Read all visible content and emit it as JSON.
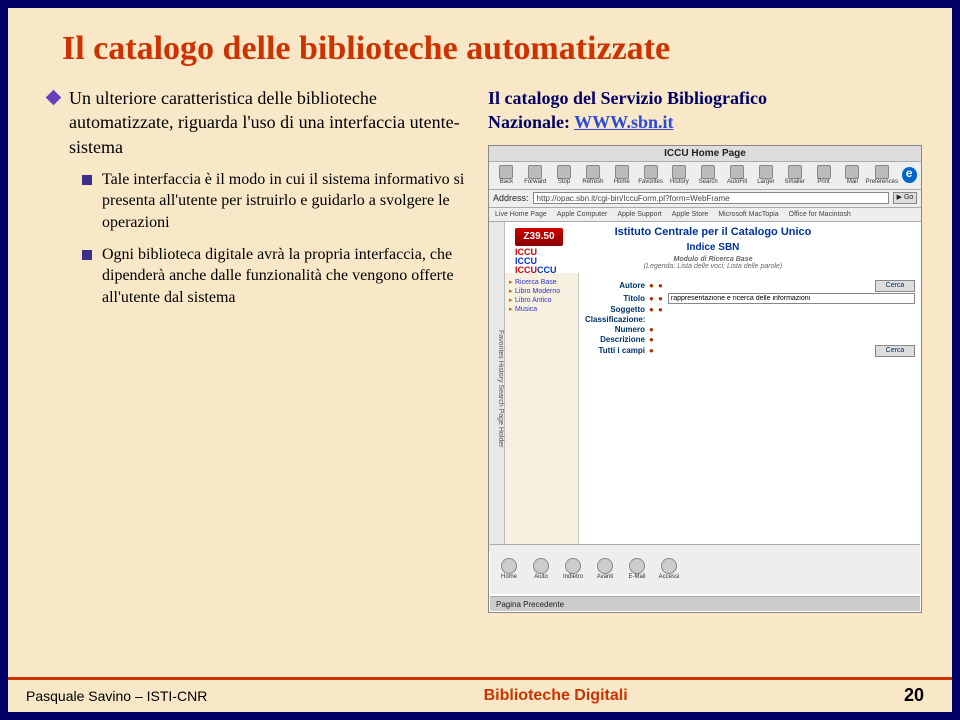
{
  "title": "Il catalogo delle biblioteche automatizzate",
  "bullets": {
    "top": "Un ulteriore caratteristica delle biblioteche automatizzate, riguarda l'uso di una interfaccia utente-sistema",
    "sub1": "Tale interfaccia è il modo in cui il sistema informativo si presenta all'utente per istruirlo e guidarlo a svolgere le operazioni",
    "sub2": "Ogni biblioteca digitale avrà la propria interfaccia, che dipenderà anche dalle funzionalità che vengono offerte all'utente dal sistema"
  },
  "right": {
    "line1": "Il catalogo del Servizio Bibliografico",
    "line2_pre": "Nazionale:   ",
    "link_text": "WWW.sbn.it"
  },
  "screenshot": {
    "window_title": "ICCU Home Page",
    "toolbar": [
      "Back",
      "Forward",
      "Stop",
      "Refresh",
      "Home",
      "Favorites",
      "History",
      "Search",
      "AutoFill",
      "Larger",
      "Smaller",
      "Print",
      "Mail",
      "Preferences"
    ],
    "address_label": "Address:",
    "address_value": "http://opac.sbn.it/cgi-bin/IccuForm.pl?form=WebFrame",
    "go": "Go",
    "bookmarks": [
      "Live Home Page",
      "Apple Computer",
      "Apple Support",
      "Apple Store",
      "Microsoft MacTopia",
      "Office for Macintosh"
    ],
    "left_tabs": "Favorites   History   Search   Page Holder",
    "z39": "Z39.50",
    "iccu": "ICCU",
    "header1": "Istituto Centrale per il Catalogo Unico",
    "header2": "Indice SBN",
    "legend_title": "Modulo di Ricerca Base",
    "legend_note": "(Legenda:  Lista delle voci;  Lista delle parole)",
    "left_panel": {
      "ricerca": "Ricerca Base",
      "moderno": "Libro Moderno",
      "antico": "Libro Antico",
      "musica": "Musica"
    },
    "form": {
      "autore": "Autore",
      "titolo": "Titolo",
      "soggetto": "Soggetto",
      "classificazione": "Classificazione:",
      "numero": "Numero",
      "descrizione": "Descrizione",
      "tutti": "Tutti i campi",
      "titolo_value": "rappresentazione e ricerca delle informazioni",
      "cerca": "Cerca"
    },
    "bottom": [
      "Home",
      "Aiuto",
      "Indietro",
      "Avanti",
      "E-Mail",
      "Accessi"
    ],
    "status": "Pagina Precedente"
  },
  "footer": {
    "left": "Pasquale Savino – ISTI-CNR",
    "mid": "Biblioteche Digitali",
    "right": "20"
  }
}
